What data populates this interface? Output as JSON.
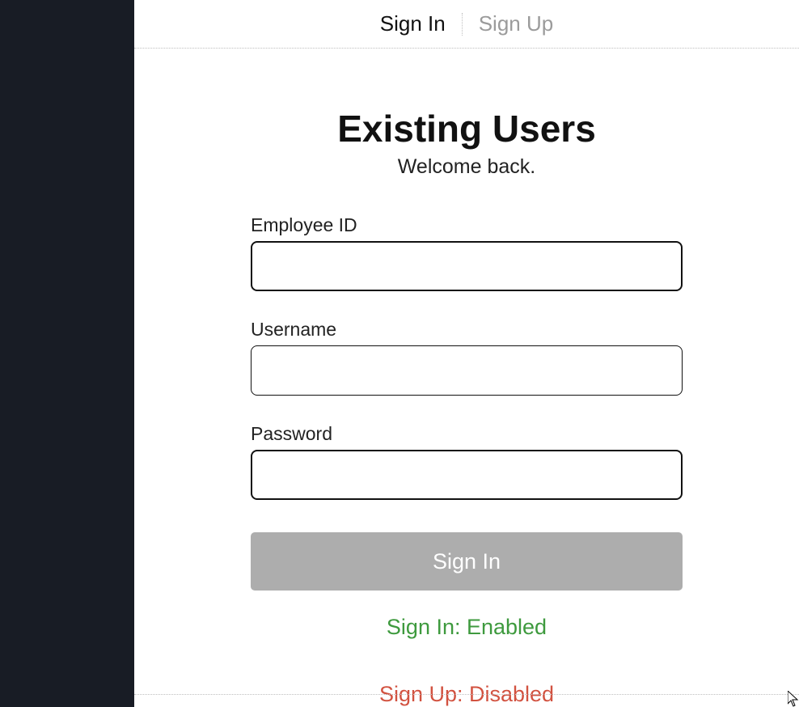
{
  "tabs": {
    "signin": "Sign In",
    "signup": "Sign Up"
  },
  "header": {
    "title": "Existing Users",
    "subtitle": "Welcome back."
  },
  "form": {
    "employee_id": {
      "label": "Employee ID",
      "value": ""
    },
    "username": {
      "label": "Username",
      "value": ""
    },
    "password": {
      "label": "Password",
      "value": ""
    },
    "submit_label": "Sign In"
  },
  "status": {
    "signin": "Sign In: Enabled",
    "signup": "Sign Up: Disabled"
  },
  "colors": {
    "sidebar_bg": "#181c25",
    "enabled_text": "#3e9a3e",
    "disabled_text": "#d25240",
    "button_bg": "#adadad"
  }
}
